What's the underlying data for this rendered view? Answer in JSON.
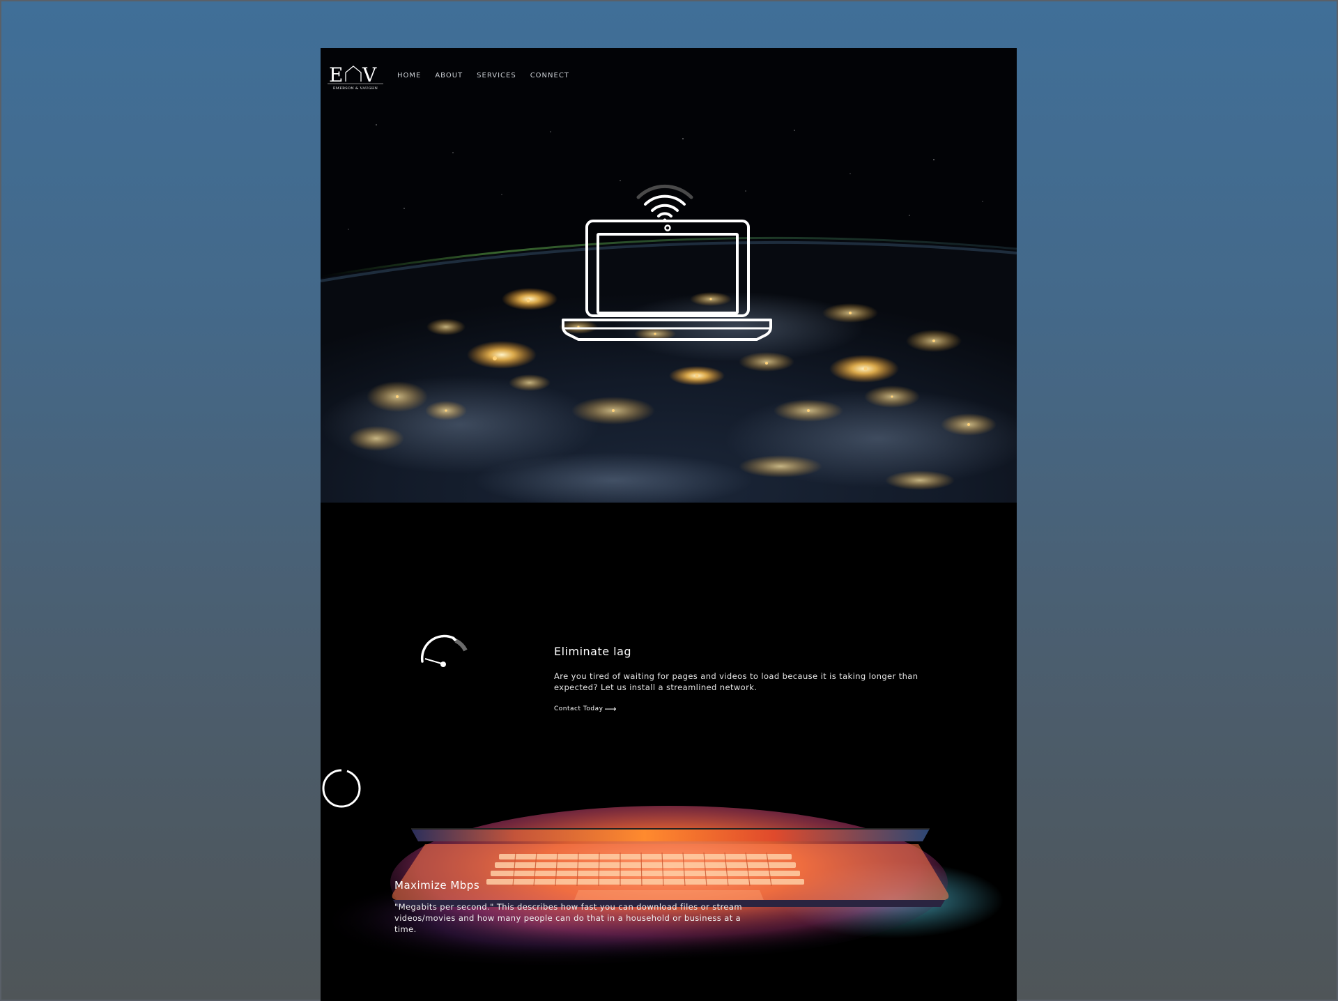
{
  "logo": {
    "monogram_left": "E",
    "monogram_right": "V",
    "tagline": "EMERSON & VAUGHN"
  },
  "nav": {
    "items": [
      "HOME",
      "ABOUT",
      "SERVICES",
      "CONNECT"
    ]
  },
  "hero": {
    "icons": [
      "wifi-icon",
      "laptop-icon"
    ]
  },
  "lag": {
    "title": "Eliminate lag",
    "body": "Are you tired of waiting for pages and videos to load because it is taking longer than expected? Let us install a streamlined network.",
    "cta": "Contact Today",
    "cta_arrow": "⟶",
    "icon": "speedometer-icon"
  },
  "mbps": {
    "title": "Maximize Mbps",
    "body": "\"Megabits per second.\" This describes how fast you can download files or stream videos/movies and how many people can do that in a household or business at a time.",
    "icon": "loading-circle-icon"
  },
  "colors": {
    "page_bg": "#000000",
    "frame_top": "#406f98",
    "frame_bottom": "#4f5558",
    "city_lights": "#ffc760",
    "text": "#ffffff"
  }
}
